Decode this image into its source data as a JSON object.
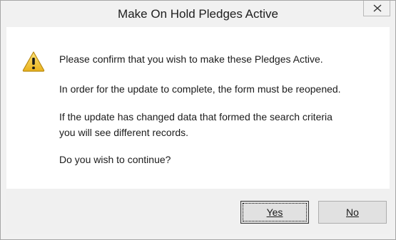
{
  "window": {
    "title": "Make On Hold Pledges Active",
    "close_icon": "close-icon"
  },
  "message": {
    "icon": "warning-icon",
    "icon_color": "#f2c12e",
    "line1": "Please confirm that you wish to make these Pledges Active.",
    "line2": "In order for the update to complete, the form must be reopened.",
    "line3a": "If the update has changed data that formed the search criteria",
    "line3b": "you will see different records.",
    "line4": "Do you wish to continue?"
  },
  "buttons": {
    "yes_label": "Yes",
    "no_label": "No"
  }
}
